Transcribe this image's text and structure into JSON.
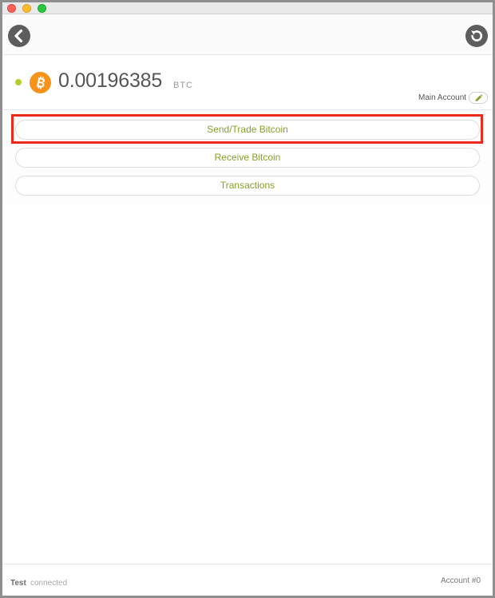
{
  "header": {
    "back_icon": "chevron-left-icon",
    "refresh_icon": "refresh-icon"
  },
  "balance": {
    "amount": "0.00196385",
    "unit": "BTC",
    "status_color": "#b5cc2b",
    "coin_icon": "bitcoin-icon",
    "coin_color": "#f7931a"
  },
  "account": {
    "name": "Main Account",
    "edit_icon": "pencil-icon"
  },
  "actions": {
    "send_label": "Send/Trade Bitcoin",
    "receive_label": "Receive Bitcoin",
    "transactions_label": "Transactions",
    "label_color": "#86a02b",
    "highlight_color": "#ec2a1c"
  },
  "footer": {
    "network_name": "Test",
    "network_status": "connected",
    "account_index": "Account #0"
  }
}
